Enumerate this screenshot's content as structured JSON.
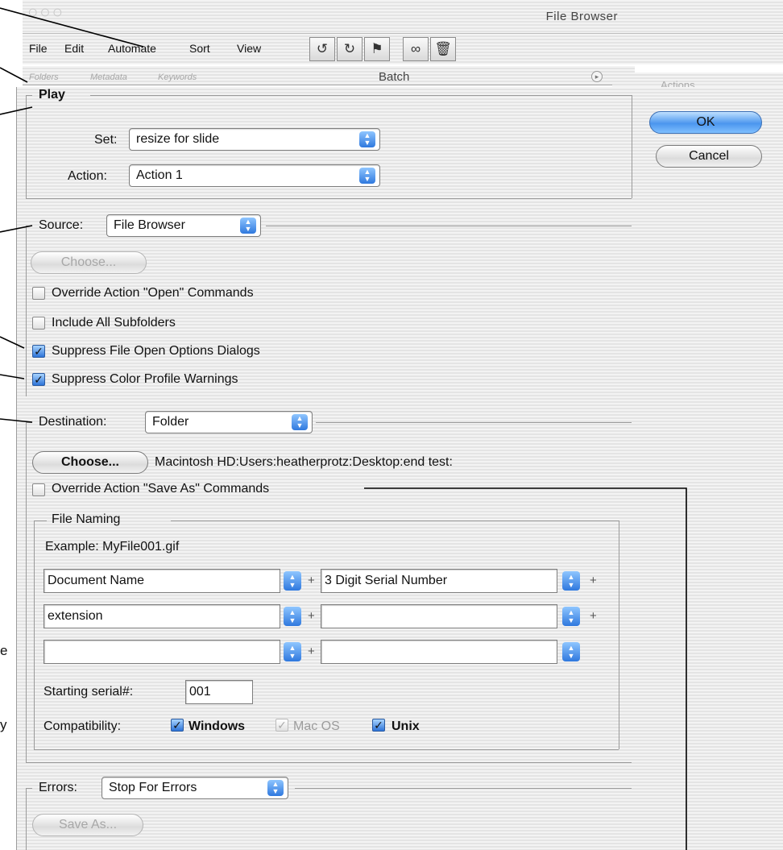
{
  "file_browser": {
    "title": "File Browser",
    "menu": [
      "File",
      "Edit",
      "Automate",
      "Sort",
      "View"
    ],
    "toolbar_icons": [
      "rotate-left-icon",
      "rotate-right-icon",
      "flag-icon",
      "binoculars-icon",
      "trash-icon"
    ],
    "palette_tabs": [
      "Folders",
      "Metadata",
      "Keywords"
    ],
    "palette_title": "Batch",
    "actions_tab": "Actions"
  },
  "play": {
    "legend": "Play",
    "set_label": "Set:",
    "set_value": "resize for slide",
    "action_label": "Action:",
    "action_value": "Action 1"
  },
  "buttons": {
    "ok": "OK",
    "cancel": "Cancel"
  },
  "source": {
    "legend": "Source:",
    "value": "File Browser",
    "choose": "Choose...",
    "override_open": "Override Action \"Open\" Commands",
    "include_subfolders": "Include All Subfolders",
    "suppress_open": "Suppress File Open Options Dialogs",
    "suppress_color": "Suppress Color Profile Warnings",
    "override_open_checked": false,
    "include_subfolders_checked": false,
    "suppress_open_checked": true,
    "suppress_color_checked": true
  },
  "destination": {
    "legend": "Destination:",
    "value": "Folder",
    "choose": "Choose...",
    "path": "Macintosh HD:Users:heatherprotz:Desktop:end test:",
    "override_save": "Override Action \"Save As\" Commands",
    "override_save_checked": false
  },
  "file_naming": {
    "legend": "File Naming",
    "example": "Example: MyFile001.gif",
    "rows": [
      [
        "Document Name",
        "3 Digit Serial Number"
      ],
      [
        "extension",
        ""
      ],
      [
        "",
        ""
      ]
    ],
    "starting_serial_label": "Starting serial#:",
    "starting_serial_value": "001",
    "compatibility_label": "Compatibility:",
    "windows": "Windows",
    "macos": "Mac OS",
    "unix": "Unix"
  },
  "errors": {
    "legend": "Errors:",
    "value": "Stop For Errors",
    "save_as": "Save As..."
  },
  "margin_text": {
    "e": "e",
    "y": "y"
  },
  "colors": {
    "aqua_blue": "#2f78de",
    "stripe_light": "#f3f3f3",
    "stripe_dark": "#e4e4e4"
  }
}
